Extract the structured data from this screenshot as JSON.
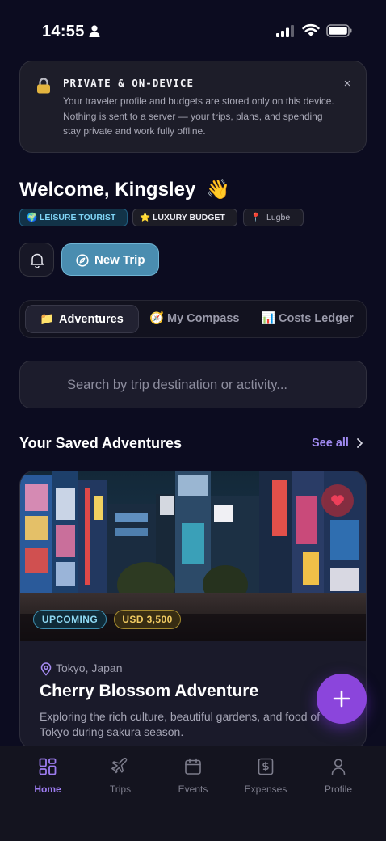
{
  "status_bar": {
    "time": "14:55"
  },
  "privacy_notice": {
    "title": "PRIVATE & ON-DEVICE",
    "body": "Your traveler profile and budgets are stored only on this device. Nothing is sent to a server — your trips, plans, and spending stay private and work fully offline.",
    "close_glyph": "×"
  },
  "welcome": {
    "text": "Welcome, Kingsley",
    "emoji": "👋"
  },
  "profile_chips": [
    {
      "emoji": "🌍",
      "label": "LEISURE TOURIST"
    },
    {
      "emoji": "⭐",
      "label": "LUXURY BUDGET"
    },
    {
      "emoji": "📍",
      "label": "Lugbe"
    }
  ],
  "actions": {
    "new_trip_label": "New Trip"
  },
  "tabs": [
    {
      "emoji": "📁",
      "label": "Adventures",
      "active": true
    },
    {
      "emoji": "🧭",
      "label": "My Compass",
      "active": false
    },
    {
      "emoji": "📊",
      "label": "Costs Ledger",
      "active": false
    }
  ],
  "search": {
    "placeholder": "Search by trip destination or activity..."
  },
  "saved_section": {
    "title": "Your Saved Adventures",
    "see_all_label": "See all"
  },
  "trip_card": {
    "status_badge": "UPCOMING",
    "budget_badge": "USD 3,500",
    "location": "Tokyo, Japan",
    "title": "Cherry Blossom Adventure",
    "description": "Exploring the rich culture, beautiful gardens, and food of Tokyo during sakura season.",
    "favorited": true
  },
  "fab": {
    "icon": "plus-icon"
  },
  "bottom_nav": [
    {
      "label": "Home",
      "icon": "grid-icon",
      "active": true
    },
    {
      "label": "Trips",
      "icon": "airplane-icon",
      "active": false
    },
    {
      "label": "Events",
      "icon": "calendar-icon",
      "active": false
    },
    {
      "label": "Expenses",
      "icon": "receipt-icon",
      "active": false
    },
    {
      "label": "Profile",
      "icon": "person-icon",
      "active": false
    }
  ],
  "colors": {
    "background": "#0c0c20",
    "accent_purple": "#8b45dc",
    "accent_blue": "#4a8db0",
    "nav_active": "#9d7cf0"
  }
}
